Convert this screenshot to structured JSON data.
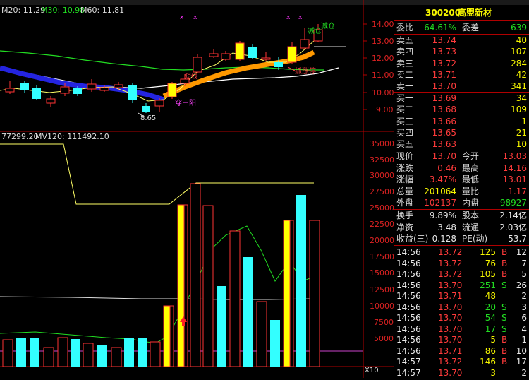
{
  "header": {
    "ma20": "M20: 11.29",
    "ma30": "M30: 10.98",
    "ma60": "M60: 11.81"
  },
  "volume_header": {
    "mv_left": "77299.20",
    "mv120": "MV120: 111492.10"
  },
  "price_axis": [
    "14.00",
    "13.00",
    "12.00",
    "11.00",
    "10.00",
    "9.00"
  ],
  "volume_axis": [
    "35000",
    "32500",
    "30000",
    "27500",
    "25000",
    "22500",
    "20000",
    "17500",
    "15000",
    "12500",
    "10000",
    "7500",
    "5000"
  ],
  "axis_unit": "X10",
  "annotations": {
    "low": "8.65",
    "three_yang": "穿三阳",
    "reduce1": "减仓",
    "reduce2": "减仓",
    "limit_up": "抓涨停",
    "short": "短线"
  },
  "colors": {
    "up": "#ff3333",
    "down": "#33ffff",
    "yellow": "#ffff00",
    "orange": "#ff9900",
    "blue": "#2020dd",
    "green": "#22dd22"
  },
  "stock": {
    "code": "300200",
    "name": "高盟新材"
  },
  "commission": {
    "ratio_label": "委比",
    "ratio": "-64.61%",
    "diff_label": "委差",
    "diff": "-639"
  },
  "asks": [
    {
      "label": "卖五",
      "price": "13.74",
      "vol": "40"
    },
    {
      "label": "卖四",
      "price": "13.73",
      "vol": "107"
    },
    {
      "label": "卖三",
      "price": "13.72",
      "vol": "284"
    },
    {
      "label": "卖二",
      "price": "13.71",
      "vol": "42"
    },
    {
      "label": "卖一",
      "price": "13.70",
      "vol": "341"
    }
  ],
  "bids": [
    {
      "label": "买一",
      "price": "13.69",
      "vol": "34"
    },
    {
      "label": "买二",
      "price": "13.68",
      "vol": "109"
    },
    {
      "label": "买三",
      "price": "13.66",
      "vol": "1"
    },
    {
      "label": "买四",
      "price": "13.65",
      "vol": "21"
    },
    {
      "label": "买五",
      "price": "13.63",
      "vol": "10"
    }
  ],
  "quote": [
    {
      "l1": "现价",
      "v1": "13.70",
      "l2": "今开",
      "v2": "13.03"
    },
    {
      "l1": "涨跌",
      "v1": "0.46",
      "l2": "最高",
      "v2": "14.16"
    },
    {
      "l1": "涨幅",
      "v1": "3.47%",
      "l2": "最低",
      "v2": "13.01"
    },
    {
      "l1": "总量",
      "v1": "201064",
      "l2": "量比",
      "v2": "1.17"
    },
    {
      "l1": "外盘",
      "v1": "102137",
      "l2": "内盘",
      "v2": "98927"
    }
  ],
  "stats": [
    {
      "l1": "换手",
      "v1": "9.89%",
      "l2": "股本",
      "v2": "2.14亿"
    },
    {
      "l1": "净资",
      "v1": "3.48",
      "l2": "流通",
      "v2": "2.03亿"
    },
    {
      "l1": "收益(三)",
      "v1": "0.128",
      "l2": "PE(动)",
      "v2": "53.7"
    }
  ],
  "ticks": [
    {
      "time": "14:56",
      "price": "13.72",
      "vol": "125",
      "dir": "B",
      "n": "12"
    },
    {
      "time": "14:56",
      "price": "13.72",
      "vol": "76",
      "dir": "B",
      "n": "7"
    },
    {
      "time": "14:56",
      "price": "13.72",
      "vol": "105",
      "dir": "B",
      "n": "5"
    },
    {
      "time": "14:56",
      "price": "13.70",
      "vol": "251",
      "dir": "S",
      "n": "26"
    },
    {
      "time": "14:56",
      "price": "13.71",
      "vol": "48",
      "dir": "",
      "n": "2"
    },
    {
      "time": "14:56",
      "price": "13.70",
      "vol": "20",
      "dir": "S",
      "n": "3"
    },
    {
      "time": "14:56",
      "price": "13.70",
      "vol": "54",
      "dir": "S",
      "n": "6"
    },
    {
      "time": "14:56",
      "price": "13.70",
      "vol": "17",
      "dir": "S",
      "n": "4"
    },
    {
      "time": "14:56",
      "price": "13.70",
      "vol": "5",
      "dir": "B",
      "n": "1"
    },
    {
      "time": "14:56",
      "price": "13.71",
      "vol": "86",
      "dir": "B",
      "n": "10"
    },
    {
      "time": "14:57",
      "price": "13.72",
      "vol": "146",
      "dir": "B",
      "n": "17"
    },
    {
      "time": "14:57",
      "price": "13.70",
      "vol": "3",
      "dir": "",
      "n": "2"
    }
  ]
}
